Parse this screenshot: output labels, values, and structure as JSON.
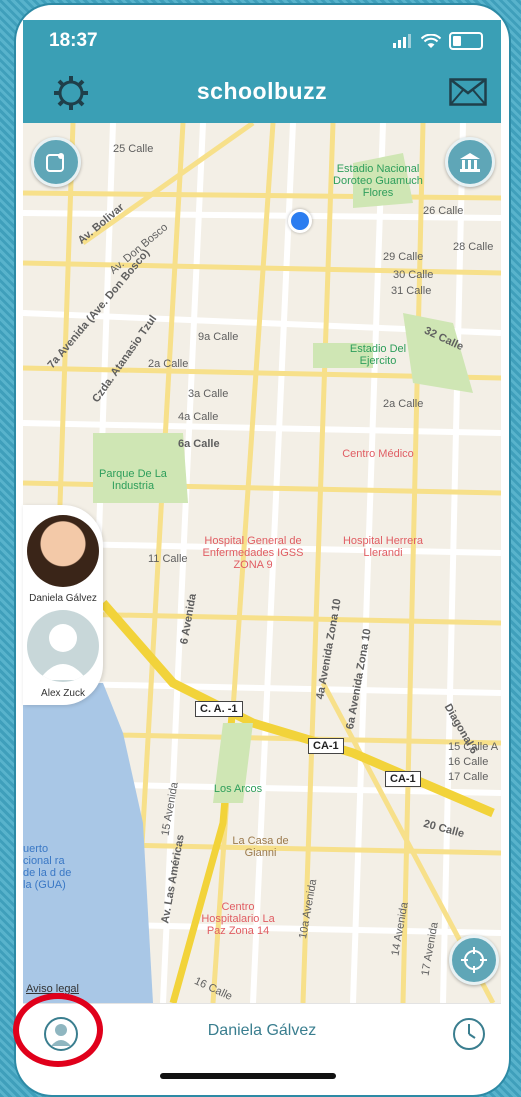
{
  "status": {
    "time": "18:37"
  },
  "header": {
    "logo": "schoolbuzz"
  },
  "map": {
    "labels": [
      "25 Calle",
      "Av. Bolivar",
      "Av. Don Bosco",
      "7a Avenida (Ave. Don Bosco)",
      "Czda. Atanasio Tzul",
      "9a Calle",
      "2a Calle",
      "3a Calle",
      "4a Calle",
      "6a Calle",
      "26 Calle",
      "29 Calle",
      "30 Calle",
      "31 Calle",
      "28 Calle",
      "32 Calle",
      "2a Calle",
      "11 Calle",
      "20 Calle",
      "15 Calle A",
      "16 Calle",
      "17 Calle",
      "Diagonal 6",
      "Av. Las Américas",
      "6 Avenida",
      "4a Avenida Zona 10",
      "6a Avenida Zona 10",
      "15 Avenida",
      "10a Avenida",
      "14 Avenida",
      "17 Avenida",
      "16 Calle"
    ],
    "pois": [
      {
        "name": "Estadio Nacional Doroteo Guamuch Flores",
        "type": "green"
      },
      {
        "name": "Estadio Del Ejercito",
        "type": "green"
      },
      {
        "name": "Parque De La Industria",
        "type": "green"
      },
      {
        "name": "Los Arcos",
        "type": "green"
      },
      {
        "name": "Centro Médico",
        "type": "red"
      },
      {
        "name": "Hospital General de Enfermedades IGSS ZONA 9",
        "type": "red"
      },
      {
        "name": "Hospital Herrera Llerandi",
        "type": "red"
      },
      {
        "name": "La Casa de Gianni",
        "type": "brown"
      },
      {
        "name": "Centro Hospitalario La Paz Zona 14",
        "type": "red"
      },
      {
        "name": "uerto cional ra de la d de la (GUA)",
        "type": "blue"
      }
    ],
    "road_signs": [
      "C. A. -1",
      "CA-1",
      "CA-1"
    ],
    "legal": "Aviso legal"
  },
  "children": [
    {
      "name": "Daniela Gálvez"
    },
    {
      "name": "Alex Zuck"
    }
  ],
  "bottom": {
    "selected_name": "Daniela Gálvez"
  },
  "colors": {
    "header": "#3a9fb5",
    "accent": "#e0001b"
  }
}
